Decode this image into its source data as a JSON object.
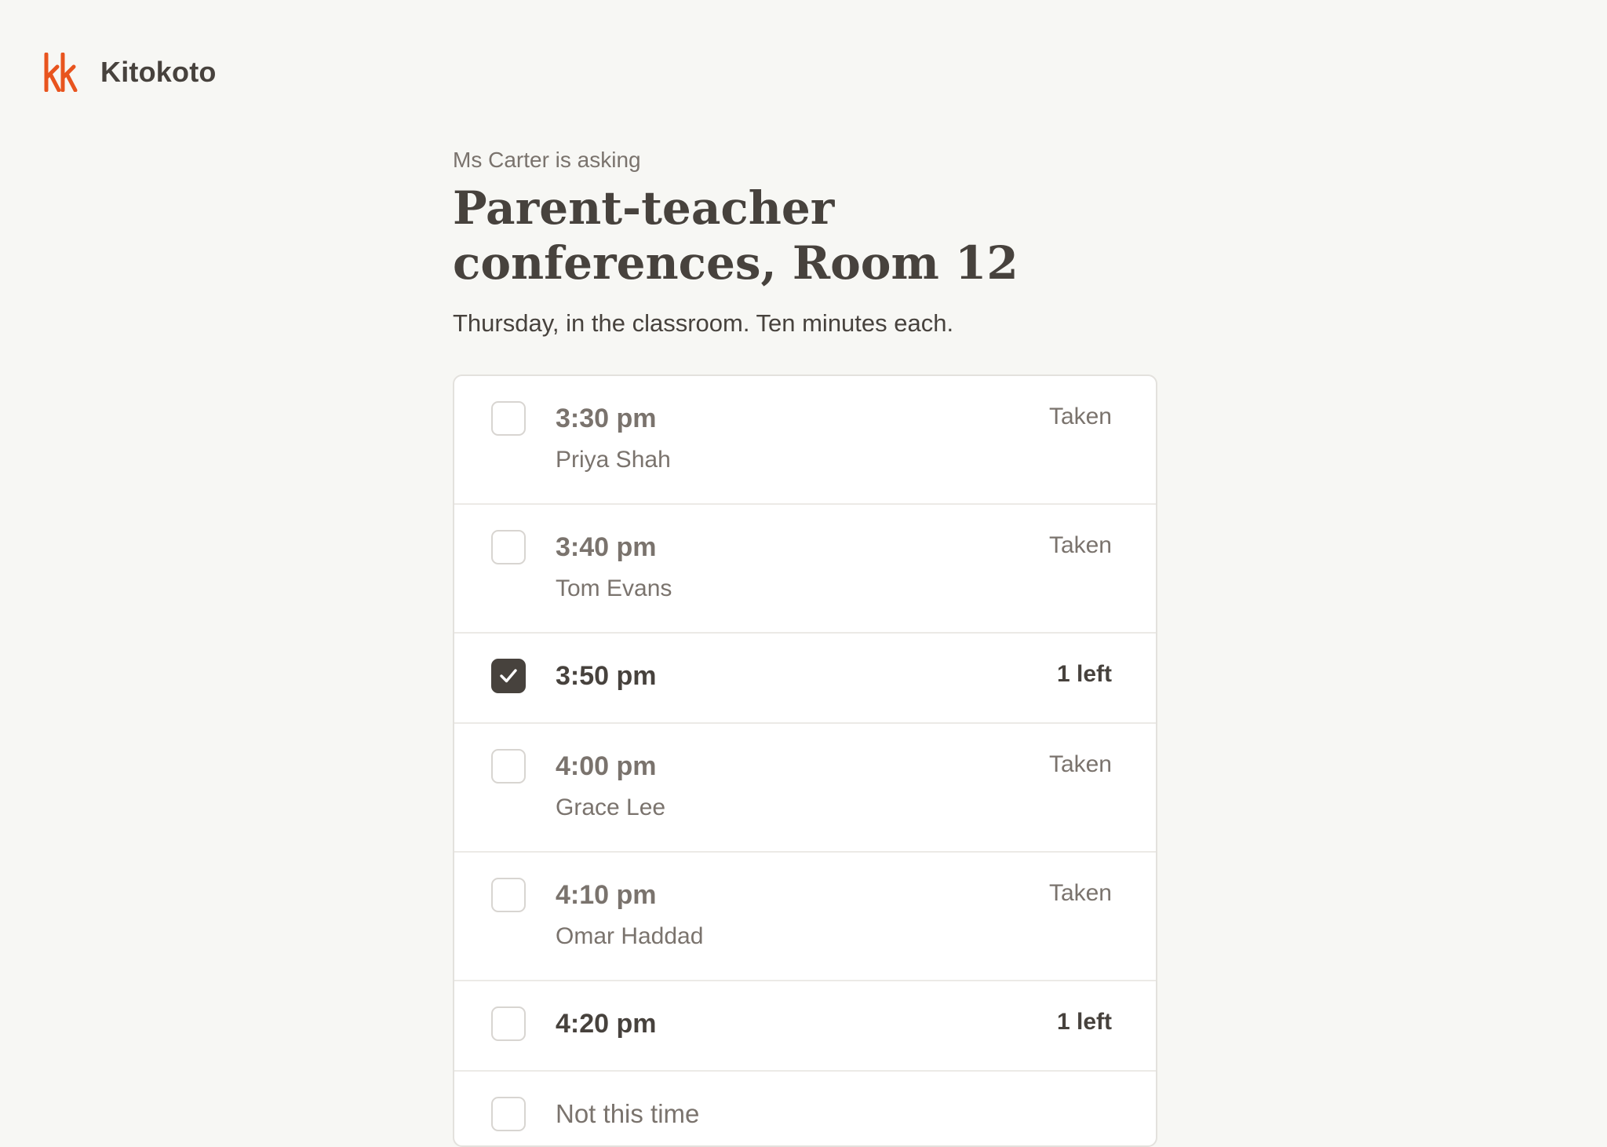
{
  "brand": {
    "name": "Kitokoto",
    "accent_color": "#e8541e",
    "logo_icon": "kk-logo-icon"
  },
  "poll": {
    "asker": "Ms Carter is asking",
    "title": "Parent-teacher conferences, Room 12",
    "subtitle": "Thursday, in the classroom. Ten minutes each."
  },
  "slots": [
    {
      "time": "3:30 pm",
      "name": "Priya Shah",
      "status": "Taken",
      "checked": false
    },
    {
      "time": "3:40 pm",
      "name": "Tom Evans",
      "status": "Taken",
      "checked": false
    },
    {
      "time": "3:50 pm",
      "name": "",
      "status": "1 left",
      "checked": true
    },
    {
      "time": "4:00 pm",
      "name": "Grace Lee",
      "status": "Taken",
      "checked": false
    },
    {
      "time": "4:10 pm",
      "name": "Omar Haddad",
      "status": "Taken",
      "checked": false
    },
    {
      "time": "4:20 pm",
      "name": "",
      "status": "1 left",
      "checked": false
    }
  ],
  "decline_option": {
    "label": "Not this time",
    "checked": false
  },
  "colors": {
    "background": "#f7f7f4",
    "text_primary": "#47423d",
    "text_muted": "#7a736d",
    "checked_fill": "#47423d"
  }
}
